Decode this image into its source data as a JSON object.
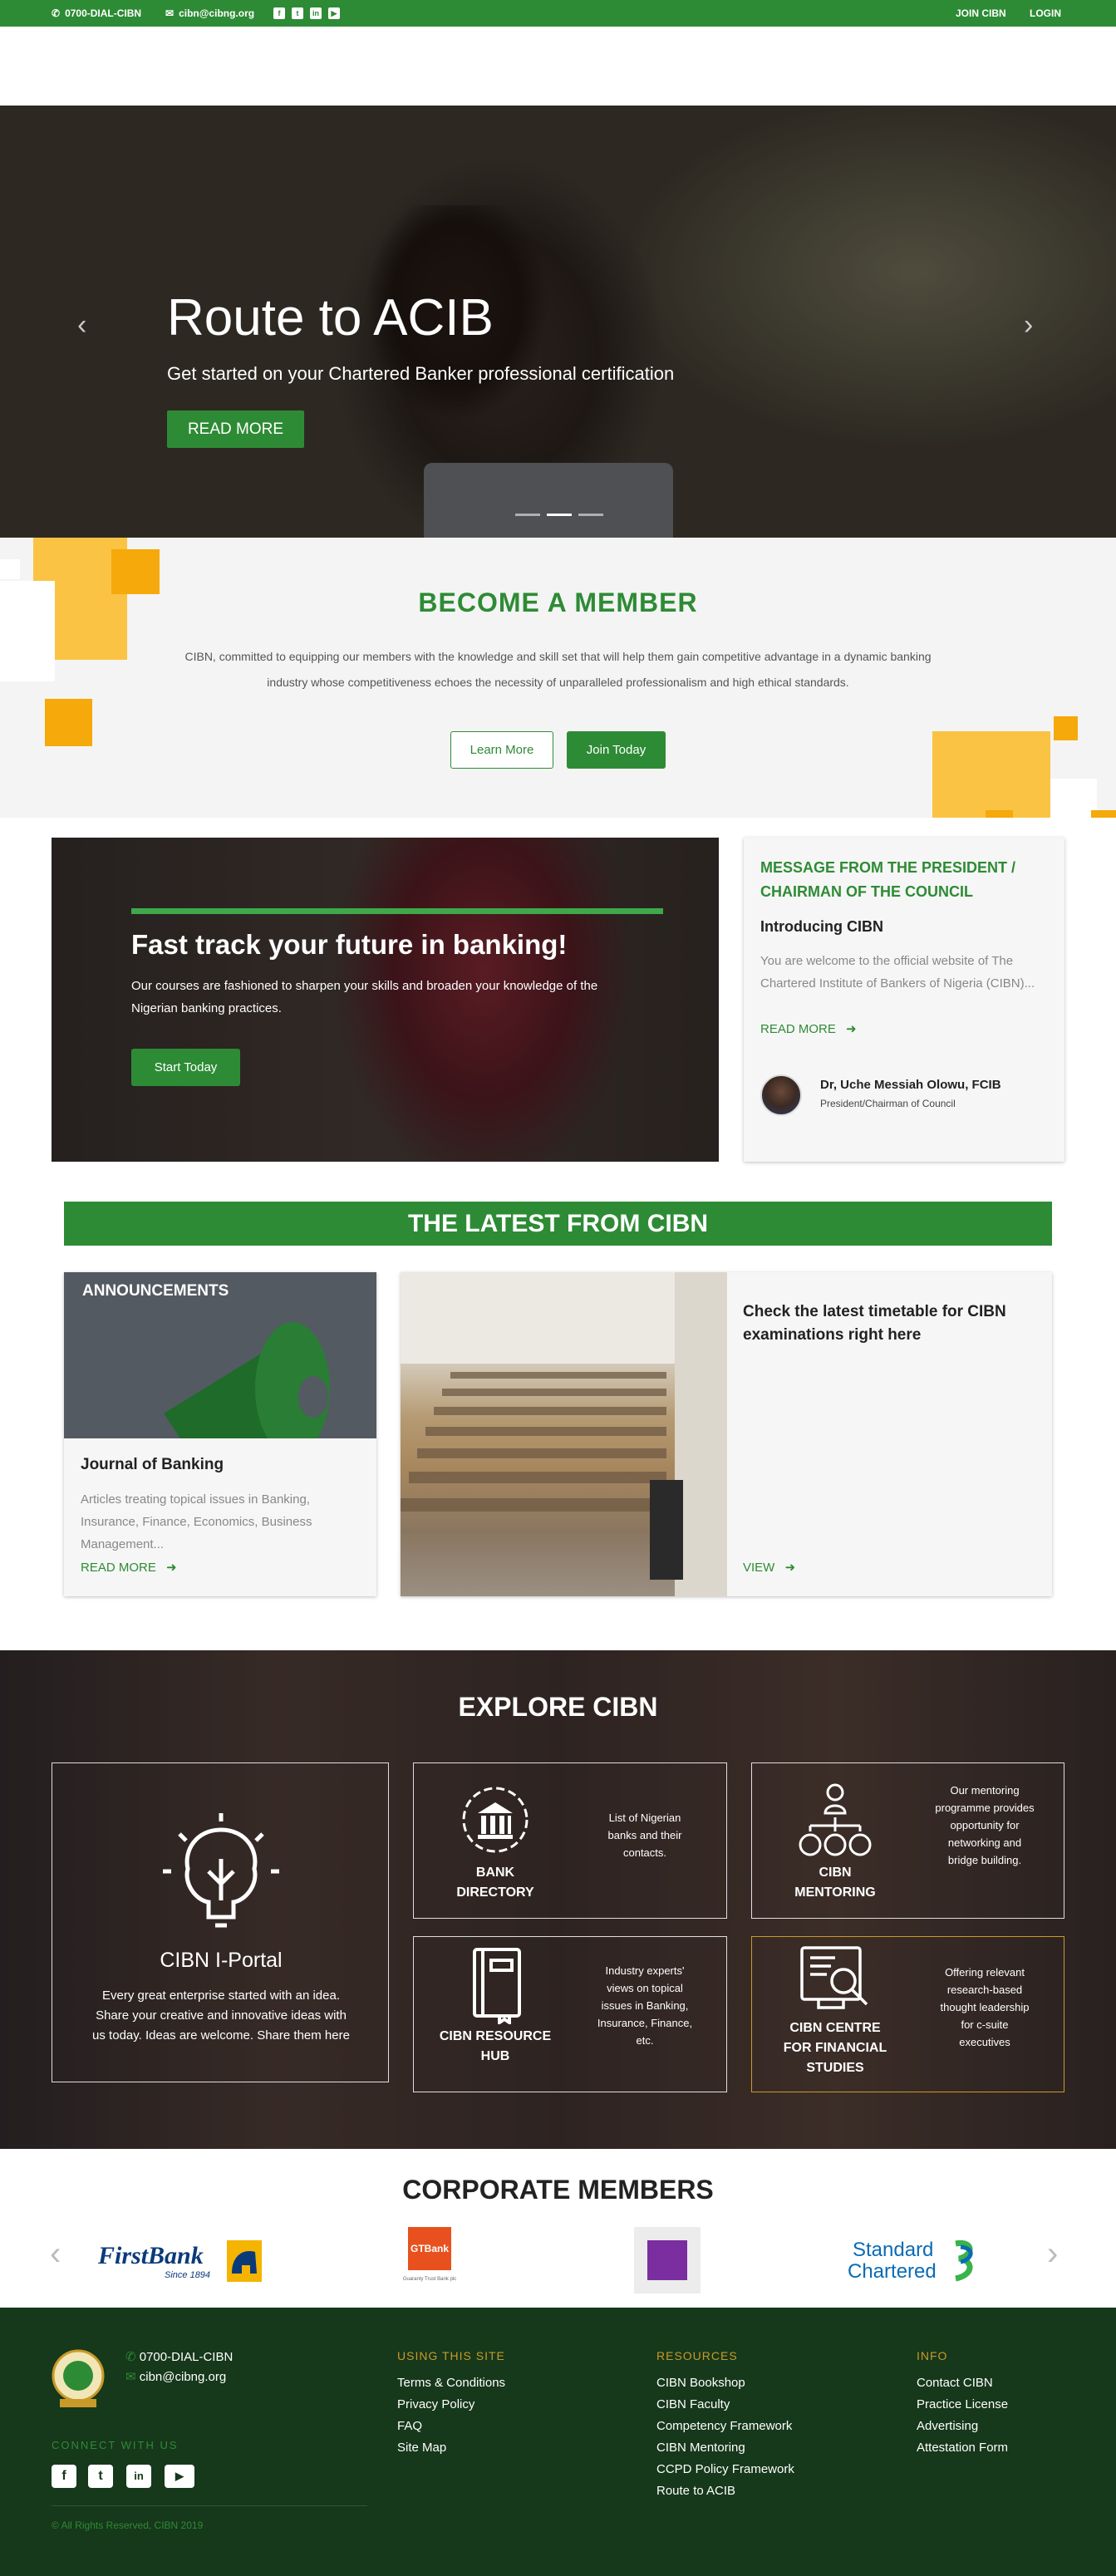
{
  "topbar": {
    "phone": "0700-DIAL-CIBN",
    "email": "cibn@cibng.org",
    "join": "JOIN CIBN",
    "login": "LOGIN",
    "social": [
      "facebook-icon",
      "twitter-icon",
      "linkedin-icon",
      "youtube-icon"
    ]
  },
  "hero": {
    "title": "Route to ACIB",
    "subtitle": "Get started on your Chartered Banker professional certification",
    "button": "READ MORE",
    "active_slide": 2,
    "slide_count": 3
  },
  "member": {
    "heading": "BECOME A MEMBER",
    "text": "CIBN, committed to equipping our members with the knowledge and skill set that will help them gain competitive advantage in a dynamic banking industry whose competitiveness echoes the necessity of unparalleled professionalism and high ethical standards.",
    "learn_more": "Learn More",
    "join_today": "Join Today"
  },
  "fasttrack": {
    "heading": "Fast track your future in banking!",
    "text": "Our courses are fashioned to sharpen your skills and broaden your knowledge of the Nigerian banking practices.",
    "button": "Start Today"
  },
  "president": {
    "title": "MESSAGE FROM THE PRESIDENT / CHAIRMAN OF THE COUNCIL",
    "subtitle": "Introducing CIBN",
    "text": "You are welcome to the official website of The Chartered Institute of Bankers of Nigeria (CIBN)...",
    "read_more": "READ MORE",
    "name": "Dr, Uche Messiah Olowu, FCIB",
    "role": "President/Chairman of Council"
  },
  "latest": {
    "heading": "THE LATEST FROM CIBN",
    "announcement_label": "ANNOUNCEMENTS",
    "journal_title": "Journal of Banking",
    "journal_text": "Articles treating topical issues in Banking, Insurance, Finance, Economics, Business Management...",
    "journal_link": "READ MORE",
    "exam_title": "Check the latest timetable for CIBN examinations right here",
    "exam_link": "VIEW"
  },
  "explore": {
    "heading": "EXPLORE CIBN",
    "portal_title": "CIBN I-Portal",
    "portal_text": "Every great enterprise started with an idea. Share your creative and innovative ideas with us today. Ideas are welcome. Share them here",
    "bank_title": "BANK DIRECTORY",
    "bank_text": "List of Nigerian banks and their contacts.",
    "mentoring_title": "CIBN MENTORING",
    "mentoring_text": "Our mentoring programme provides opportunity for networking and bridge building.",
    "resource_title": "CIBN RESOURCE HUB",
    "resource_text": "Industry experts' views on topical issues in Banking, Insurance, Finance, etc.",
    "centre_title": "CIBN CENTRE FOR FINANCIAL STUDIES",
    "centre_text": "Offering relevant research-based thought leadership for c-suite executives"
  },
  "corporate": {
    "heading": "CORPORATE MEMBERS",
    "firstbank": "FirstBank",
    "firstbank_tag": "Since 1894",
    "gtbank": "GTBank",
    "gtbank_tag": "Guaranty Trust Bank plc",
    "sc1": "Standard",
    "sc2": "Chartered"
  },
  "footer": {
    "phone": "0700-DIAL-CIBN",
    "email": "cibn@cibng.org",
    "connect": "CONNECT WITH US",
    "copyright": "© All Rights Reserved, CIBN 2019",
    "using_title": "USING THIS SITE",
    "using": [
      "Terms & Conditions",
      "Privacy Policy",
      "FAQ",
      "Site Map"
    ],
    "resources_title": "RESOURCES",
    "resources": [
      "CIBN Bookshop",
      "CIBN Faculty",
      "Competency Framework",
      "CIBN Mentoring",
      "CCPD Policy Framework",
      "Route to ACIB"
    ],
    "info_title": "INFO",
    "info": [
      "Contact CIBN",
      "Practice License",
      "Advertising",
      "Attestation Form"
    ]
  },
  "colors": {
    "brand_green": "#2e8b35",
    "footer_green": "#16381b",
    "accent_yellow": "#f5a90a",
    "footer_heading": "#c99a28"
  }
}
